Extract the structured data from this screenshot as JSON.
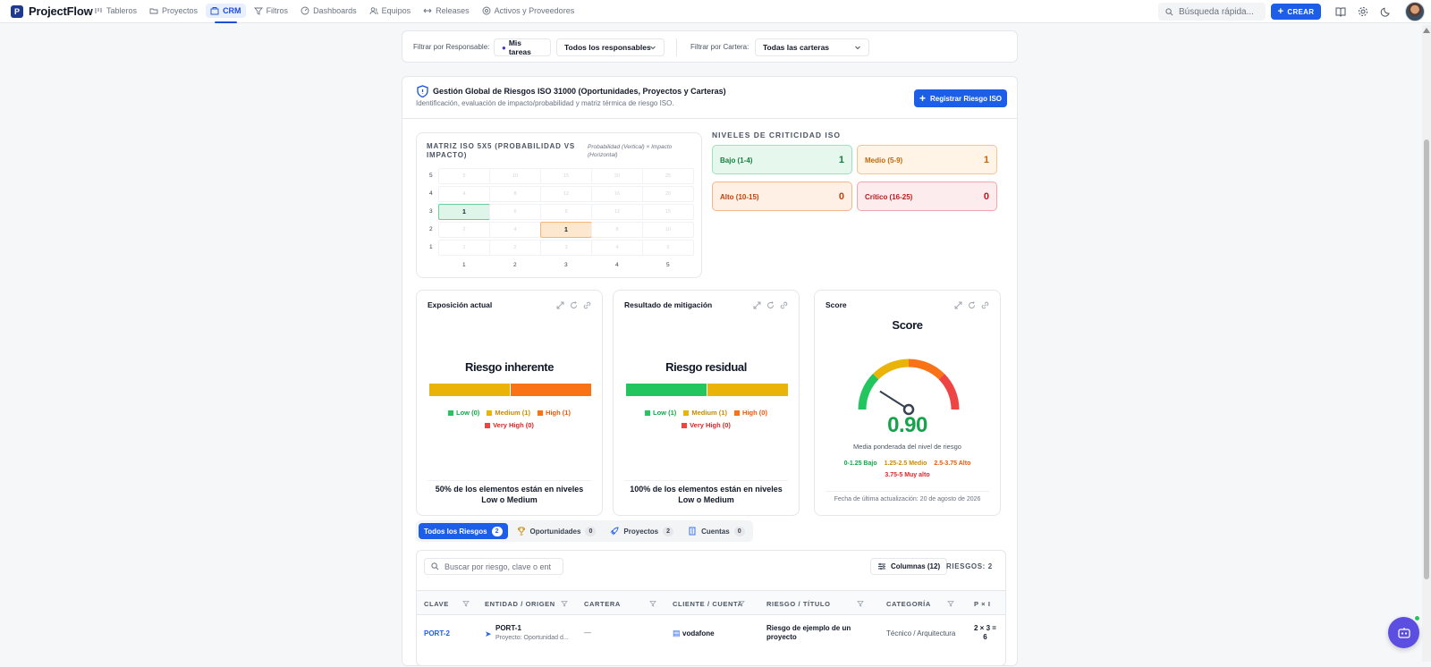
{
  "app": {
    "name": "ProjectFlow"
  },
  "nav": [
    {
      "label": "Tableros",
      "icon": "boards-icon"
    },
    {
      "label": "Proyectos",
      "icon": "folder-icon"
    },
    {
      "label": "CRM",
      "icon": "crm-icon",
      "active": true
    },
    {
      "label": "Filtros",
      "icon": "filter-icon"
    },
    {
      "label": "Dashboards",
      "icon": "dashboard-icon"
    },
    {
      "label": "Equipos",
      "icon": "team-icon"
    },
    {
      "label": "Releases",
      "icon": "release-icon"
    },
    {
      "label": "Activos y Proveedores",
      "icon": "assets-icon"
    }
  ],
  "topbar": {
    "search_placeholder": "Búsqueda rápida...",
    "create_label": "CREAR"
  },
  "filters": {
    "responsable_label": "Filtrar por Responsable:",
    "mis_tareas": "Mis tareas",
    "responsable_value": "Todos los responsables",
    "cartera_label": "Filtrar por Cartera:",
    "cartera_value": "Todas las carteras"
  },
  "header": {
    "title": "Gestión Global de Riesgos ISO 31000 (Oportunidades, Proyectos y Carteras)",
    "subtitle": "Identificación, evaluación de impacto/probabilidad y matriz térmica de riesgo ISO.",
    "register_label": "Registrar Riesgo ISO"
  },
  "matrix": {
    "title": "MATRIZ ISO 5X5 (PROBABILIDAD VS IMPACTO)",
    "note": "Probabilidad (Vertical) × Impacto (Horizontal)",
    "rows": [
      5,
      4,
      3,
      2,
      1
    ],
    "cols": [
      1,
      2,
      3,
      4,
      5
    ],
    "highlights": [
      {
        "prob": 3,
        "impact": 1,
        "count": "1",
        "color": "green"
      },
      {
        "prob": 2,
        "impact": 3,
        "count": "1",
        "color": "orange"
      }
    ]
  },
  "levels": {
    "title": "NIVELES DE CRITICIDAD ISO",
    "items": [
      {
        "label": "Bajo (1-4)",
        "count": "1",
        "cls": "bajo"
      },
      {
        "label": "Medio (5-9)",
        "count": "1",
        "cls": "medio"
      },
      {
        "label": "Alto (10-15)",
        "count": "0",
        "cls": "alto"
      },
      {
        "label": "Crítico (16-25)",
        "count": "0",
        "cls": "critico"
      }
    ]
  },
  "widgets": {
    "inherent": {
      "card_title": "Exposición actual",
      "title": "Riesgo inherente",
      "segments": [
        {
          "level": "Medium",
          "share": 0.5,
          "color": "#eab308"
        },
        {
          "level": "High",
          "share": 0.5,
          "color": "#f97316"
        }
      ],
      "legend_1": "Low (0)",
      "legend_2": "Medium (1)",
      "legend_3": "High (1)",
      "legend_4": "Very High (0)",
      "footer": "50% de los elementos están en niveles Low o Medium"
    },
    "residual": {
      "card_title": "Resultado de mitigación",
      "title": "Riesgo residual",
      "segments": [
        {
          "level": "Low",
          "share": 0.5,
          "color": "#22c55e"
        },
        {
          "level": "Medium",
          "share": 0.5,
          "color": "#eab308"
        }
      ],
      "legend_1": "Low (1)",
      "legend_2": "Medium (1)",
      "legend_3": "High (0)",
      "legend_4": "Very High (0)",
      "footer": "100% de los elementos están en niveles Low o Medium"
    },
    "score": {
      "card_title": "Score",
      "title": "Score",
      "value": "0.90",
      "gauge_max": 5,
      "description": "Media ponderada del nivel de riesgo",
      "legend_1": "0-1.25 Bajo",
      "legend_2": "1.25-2.5 Medio",
      "legend_3": "2.5-3.75 Alto",
      "legend_4": "3.75-5 Muy alto",
      "date": "Fecha de última actualización: 20 de agosto de 2026"
    }
  },
  "colors": {
    "low": "#16a34a",
    "medium": "#ca8a04",
    "high": "#ea580c",
    "very_high": "#dc2626",
    "accent": "#1d5ee8"
  },
  "tabs": [
    {
      "label": "Todos los Riesgos",
      "count": "2",
      "active": true
    },
    {
      "label": "Oportunidades",
      "count": "0"
    },
    {
      "label": "Proyectos",
      "count": "2"
    },
    {
      "label": "Cuentas",
      "count": "0"
    }
  ],
  "table": {
    "search_placeholder": "Buscar por riesgo, clave o ent",
    "columns_label": "Columnas (12)",
    "count_label": "RIESGOS: 2",
    "headers": [
      "CLAVE",
      "ENTIDAD / ORIGEN",
      "CARTERA",
      "CLIENTE / CUENTA",
      "RIESGO / TÍTULO",
      "CATEGORÍA",
      "P × I"
    ],
    "rows": [
      {
        "clave": "PORT-2",
        "entidad": "PORT-1",
        "entidad_sub": "Proyecto: Oportunidad d...",
        "cartera": "—",
        "cliente": "vodafone",
        "riesgo": "Riesgo de ejemplo de un proyecto",
        "categoria": "Técnico / Arquitectura",
        "pxi": "2 × 3 =",
        "pxi_result": "6"
      }
    ]
  }
}
